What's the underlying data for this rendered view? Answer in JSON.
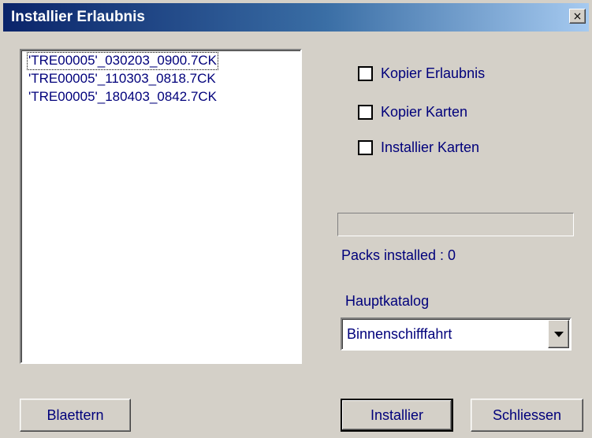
{
  "window": {
    "title": "Installier Erlaubnis",
    "close_symbol": "×"
  },
  "file_list": {
    "items": [
      "'TRE00005'_030203_0900.7CK",
      "'TRE00005'_110303_0818.7CK",
      "'TRE00005'_180403_0842.7CK"
    ],
    "focused_index": 0
  },
  "options": {
    "kopier_erlaubnis": {
      "label": "Kopier Erlaubnis",
      "checked": false
    },
    "kopier_karten": {
      "label": "Kopier Karten",
      "checked": false
    },
    "installier_karten": {
      "label": "Installier Karten",
      "checked": false
    }
  },
  "progress": {
    "value": 0
  },
  "status": {
    "packs_installed": "Packs installed : 0"
  },
  "catalog": {
    "label": "Hauptkatalog",
    "selected": "Binnenschifffahrt"
  },
  "buttons": {
    "browse": "Blaettern",
    "install": "Installier",
    "close": "Schliessen"
  },
  "icons": {
    "close": "close-icon",
    "dropdown": "chevron-down-icon"
  },
  "colors": {
    "title_start": "#0a246a",
    "title_end": "#a6caf0",
    "text": "#00007b",
    "face": "#d4d0c8"
  }
}
